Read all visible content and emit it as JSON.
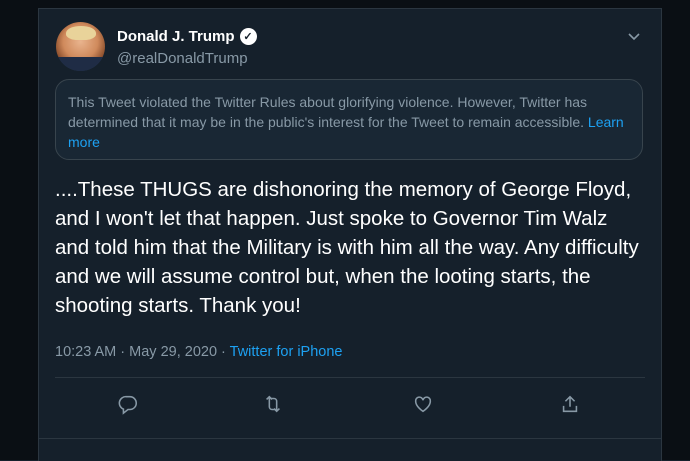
{
  "author": {
    "name": "Donald J. Trump",
    "handle": "@realDonaldTrump"
  },
  "notice": {
    "text": "This Tweet violated the Twitter Rules about glorifying violence. However, Twitter has determined that it may be in the public's interest for the Tweet to remain accessible.",
    "link_label": "Learn more"
  },
  "tweet": {
    "text": "....These THUGS are dishonoring the memory of George Floyd, and I won't let that happen. Just spoke to Governor Tim Walz and told him that the Military is with him all the way. Any difficulty and we will assume control but, when the looting starts, the shooting starts. Thank you!",
    "time": "10:23 AM · May 29, 2020 · ",
    "source": "Twitter for iPhone"
  },
  "icons": {
    "verified": "verified-badge-icon",
    "caret": "chevron-down-icon",
    "reply": "reply-icon",
    "retweet": "retweet-icon",
    "like": "heart-icon",
    "share": "share-icon"
  },
  "colors": {
    "background": "#15202b",
    "accent": "#1da1f2",
    "muted": "#8899a6"
  }
}
